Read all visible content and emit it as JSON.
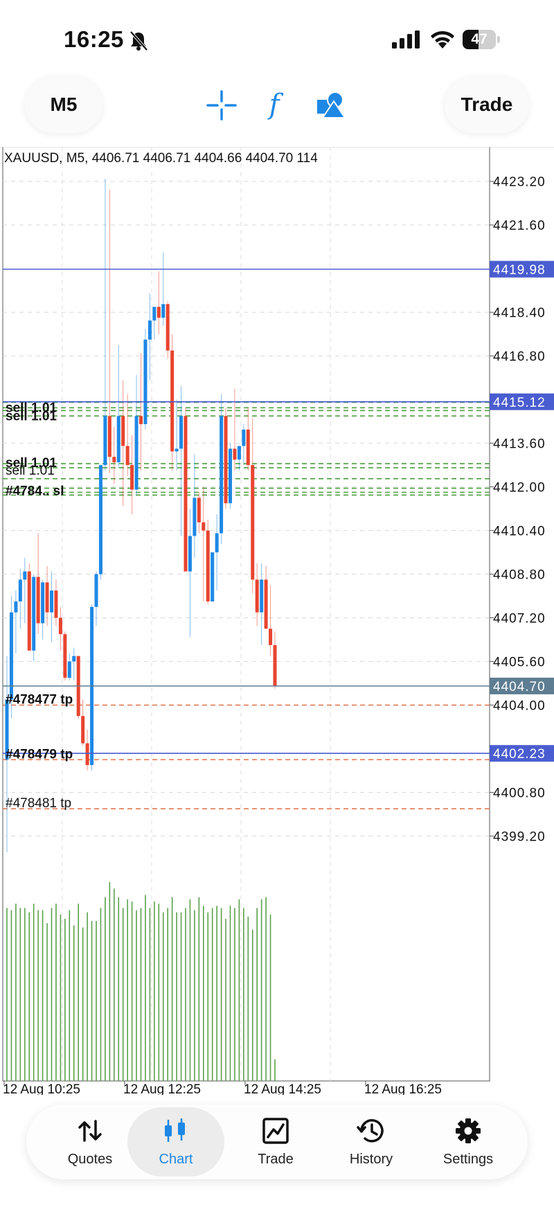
{
  "status_bar": {
    "time": "16:25",
    "battery": "47",
    "battery_level": 0.47
  },
  "toolbar": {
    "timeframe_label": "M5",
    "trade_label": "Trade",
    "icons": [
      "crosshair-icon",
      "indicator-icon",
      "objects-icon"
    ],
    "indicator_glyph": "f"
  },
  "chart": {
    "header": "XAUUSD, M5, 4406.71 4406.71 4404.66 4404.70 114",
    "colors": {
      "bull": "#1e88e5",
      "bear": "#e8442f",
      "volume": "#5aa14a",
      "price_line": "#4a5dd0",
      "bid_line": "#5e7d92",
      "order_line": "#4a9e3c",
      "tp_line": "#e07a52"
    }
  },
  "chart_data": {
    "type": "candlestick",
    "symbol": "XAUUSD",
    "timeframe": "M5",
    "last": {
      "open": 4406.71,
      "high": 4406.71,
      "low": 4404.66,
      "close": 4404.7,
      "volume": 114
    },
    "y_ticks": [
      "4423.20",
      "4421.60",
      "4418.40",
      "4416.80",
      "4413.60",
      "4412.00",
      "4410.40",
      "4408.80",
      "4407.20",
      "4405.60",
      "4404.00",
      "4400.80",
      "4399.20"
    ],
    "ylim": [
      4398.4,
      4423.6
    ],
    "x_ticks": [
      "12 Aug 10:25",
      "12 Aug 12:25",
      "12 Aug 14:25",
      "12 Aug 16:25"
    ],
    "candles": [
      [
        4402.0,
        4405.8,
        4398.6,
        4404.2
      ],
      [
        4404.2,
        4408.0,
        4403.5,
        4407.4
      ],
      [
        4407.4,
        4408.2,
        4405.9,
        4407.8
      ],
      [
        4407.8,
        4409.0,
        4406.8,
        4408.6
      ],
      [
        4408.6,
        4409.4,
        4407.0,
        4408.9
      ],
      [
        4408.9,
        4409.2,
        4406.3,
        4406.0
      ],
      [
        4406.0,
        4408.8,
        4405.6,
        4408.7
      ],
      [
        4408.7,
        4410.3,
        4406.6,
        4407.0
      ],
      [
        4407.0,
        4408.6,
        4406.4,
        4408.5
      ],
      [
        4408.5,
        4409.1,
        4406.9,
        4407.4
      ],
      [
        4407.4,
        4408.9,
        4406.3,
        4408.2
      ],
      [
        4408.2,
        4408.6,
        4406.9,
        4407.2
      ],
      [
        4407.2,
        4407.6,
        4406.0,
        4406.6
      ],
      [
        4406.6,
        4406.7,
        4404.9,
        4405.0
      ],
      [
        4405.0,
        4405.9,
        4404.9,
        4405.6
      ],
      [
        4405.6,
        4406.1,
        4404.9,
        4405.8
      ],
      [
        4405.8,
        4405.8,
        4403.5,
        4403.6
      ],
      [
        4403.6,
        4404.2,
        4402.5,
        4402.6
      ],
      [
        4402.6,
        4403.1,
        4401.6,
        4401.8
      ],
      [
        4401.8,
        4407.7,
        4401.6,
        4407.6
      ],
      [
        4407.6,
        4408.9,
        4406.9,
        4408.8
      ],
      [
        4408.8,
        4412.8,
        4408.6,
        4412.8
      ],
      [
        4412.8,
        4423.3,
        4412.6,
        4414.6
      ],
      [
        4414.6,
        4422.9,
        4412.5,
        4413.1
      ],
      [
        4413.1,
        4414.2,
        4412.1,
        4412.9
      ],
      [
        4412.9,
        4417.2,
        4412.7,
        4414.6
      ],
      [
        4414.6,
        4415.9,
        4411.3,
        4413.5
      ],
      [
        4413.5,
        4415.4,
        4412.4,
        4412.8
      ],
      [
        4412.8,
        4413.9,
        4411.0,
        4411.9
      ],
      [
        4411.9,
        4416.1,
        4411.7,
        4414.6
      ],
      [
        4414.6,
        4416.9,
        4412.6,
        4414.3
      ],
      [
        4414.3,
        4417.8,
        4414.1,
        4417.4
      ],
      [
        4417.4,
        4419.1,
        4415.9,
        4418.1
      ],
      [
        4418.1,
        4418.6,
        4417.4,
        4418.6
      ],
      [
        4418.6,
        4419.9,
        4417.6,
        4418.2
      ],
      [
        4418.2,
        4420.6,
        4417.9,
        4418.7
      ],
      [
        4418.7,
        4418.8,
        4416.7,
        4417.0
      ],
      [
        4417.0,
        4417.6,
        4412.6,
        4413.3
      ],
      [
        4413.3,
        4415.2,
        4412.6,
        4413.4
      ],
      [
        4413.4,
        4415.7,
        4410.2,
        4414.6
      ],
      [
        4414.6,
        4414.9,
        4410.4,
        4408.9
      ],
      [
        4408.9,
        4411.2,
        4406.5,
        4410.2
      ],
      [
        4410.2,
        4413.2,
        4409.4,
        4411.6
      ],
      [
        4411.6,
        4411.8,
        4410.3,
        4410.7
      ],
      [
        4410.7,
        4412.0,
        4407.8,
        4410.4
      ],
      [
        4410.4,
        4410.8,
        4407.7,
        4407.8
      ],
      [
        4407.8,
        4409.6,
        4407.8,
        4409.6
      ],
      [
        4409.6,
        4411.0,
        4408.2,
        4410.3
      ],
      [
        4410.3,
        4415.4,
        4409.9,
        4414.6
      ],
      [
        4414.6,
        4414.9,
        4411.2,
        4411.4
      ],
      [
        4411.4,
        4413.6,
        4411.2,
        4413.4
      ],
      [
        4413.4,
        4415.6,
        4412.6,
        4413.0
      ],
      [
        4413.0,
        4413.5,
        4412.6,
        4413.5
      ],
      [
        4413.5,
        4414.3,
        4412.8,
        4414.1
      ],
      [
        4414.1,
        4414.9,
        4412.6,
        4412.8
      ],
      [
        4412.8,
        4414.5,
        4408.1,
        4408.6
      ],
      [
        4408.6,
        4409.2,
        4406.9,
        4407.4
      ],
      [
        4407.4,
        4409.2,
        4406.2,
        4408.6
      ],
      [
        4408.6,
        4409.1,
        4406.9,
        4406.8
      ],
      [
        4406.8,
        4408.4,
        4405.8,
        4406.2
      ],
      [
        4406.2,
        4406.7,
        4404.6,
        4404.7
      ]
    ],
    "volume": [
      80,
      79,
      82,
      80,
      80,
      78,
      82,
      79,
      79,
      73,
      80,
      82,
      77,
      75,
      79,
      72,
      82,
      71,
      78,
      74,
      74,
      80,
      85,
      92,
      89,
      85,
      80,
      84,
      83,
      79,
      80,
      86,
      80,
      83,
      82,
      78,
      80,
      85,
      78,
      78,
      80,
      84,
      79,
      85,
      81,
      78,
      80,
      81,
      80,
      75,
      81,
      80,
      84,
      80,
      76,
      70,
      80,
      84,
      85,
      77,
      10
    ],
    "volume_ylim": [
      0,
      100
    ],
    "levels": {
      "bid": {
        "price": 4404.7,
        "label": "4404.70"
      },
      "line_upper": {
        "price": 4419.98,
        "label": "4419.98"
      },
      "line_mid": {
        "price": 4415.12,
        "label": "4415.12"
      },
      "line_lower": {
        "price": 4402.23,
        "label": "4402.23"
      },
      "sell_orders_upper": [
        4415.1,
        4414.9,
        4414.8,
        4414.6
      ],
      "sell_orders_mid": [
        4412.85,
        4412.7
      ],
      "sell_order_single": 4412.3,
      "sl_orders": [
        4411.95,
        4411.8,
        4411.7
      ],
      "tp_orders": [
        4404.0,
        4402.0,
        4400.2
      ]
    },
    "order_labels": {
      "sell_upper": "sell 1.01",
      "sell_mid": "sell 1.01",
      "sell_single": "sell 1.01",
      "sl_tag": "#4784..  sl",
      "tp1": "#478477 tp",
      "tp2": "#478479 tp",
      "tp3": "#478481 tp"
    }
  },
  "bottom_nav": {
    "items": [
      {
        "label": "Quotes",
        "icon": "quotes-icon",
        "active": false
      },
      {
        "label": "Chart",
        "icon": "chart-icon",
        "active": true
      },
      {
        "label": "Trade",
        "icon": "trade-icon",
        "active": false
      },
      {
        "label": "History",
        "icon": "history-icon",
        "active": false
      },
      {
        "label": "Settings",
        "icon": "settings-icon",
        "active": false
      }
    ]
  }
}
